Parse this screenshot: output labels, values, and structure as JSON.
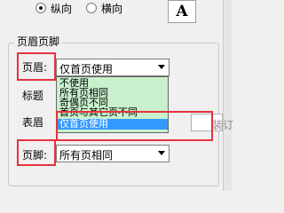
{
  "orientation": {
    "portrait_label": "纵向",
    "landscape_label": "横向",
    "selected": "portrait",
    "preview_letter": "A"
  },
  "header_footer": {
    "group_title": "页眉页脚",
    "header": {
      "label": "页眉:",
      "value": "仅首页使用"
    },
    "title_row": {
      "label": "标题"
    },
    "cover_row": {
      "label": "表眉"
    },
    "footer": {
      "label": "页脚:",
      "value": "所有页相同"
    },
    "dropdown_options": [
      {
        "label": "不使用",
        "selected": false
      },
      {
        "label": "所有页相同",
        "selected": false
      },
      {
        "label": "奇偶页不同",
        "selected": false
      },
      {
        "label": "首页与其它页不同",
        "selected": false
      },
      {
        "label": "仅首页使用",
        "selected": true
      }
    ],
    "trailing_text": "装订"
  },
  "colors": {
    "annotation_red": "#e8323c",
    "dropdown_bg": "#c8f0cc",
    "selection_blue": "#3399ff"
  }
}
